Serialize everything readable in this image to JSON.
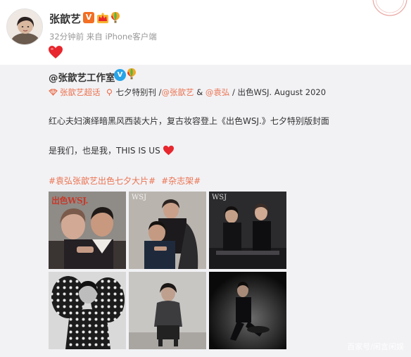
{
  "post": {
    "user_name": "张歆艺",
    "verified_badge": "V",
    "meta": "32分钟前 来自 iPhone客户端",
    "reaction": "heart-icon"
  },
  "repost": {
    "source_name": "@张歆艺工作室",
    "source_badge": "V",
    "topic_line": {
      "supertopic": "张歆艺超话",
      "issue": "七夕特别刊",
      "slash1": "/",
      "mention1": "@张歆艺",
      "amp": "&",
      "mention2": "@袁弘",
      "suffix": "/ 出色WSJ. August 2020"
    },
    "text_line1": "红心夫妇演绎暗黑风西装大片，复古妆容登上《出色WSJ.》七夕特别版封面",
    "text_line2": "是我们，也是我，THIS IS US",
    "hashtags": [
      "#袁弘张歆艺出色七夕大片#",
      "#杂志架#"
    ],
    "photos": [
      {
        "cover_text": "出色WSJ."
      },
      {
        "cover_text": "WSJ"
      },
      {
        "cover_text": "WSJ"
      },
      {
        "cover_text": ""
      },
      {
        "cover_text": ""
      },
      {
        "cover_text": ""
      }
    ]
  },
  "watermark": "百家号/闲言闲娱",
  "colors": {
    "link": "#eb7350",
    "text": "#333333",
    "meta": "#999999",
    "repost_bg": "#f2f2f5",
    "heart": "#e8262d",
    "verified_orange": "#f26f23",
    "verified_blue": "#28a4e8"
  }
}
